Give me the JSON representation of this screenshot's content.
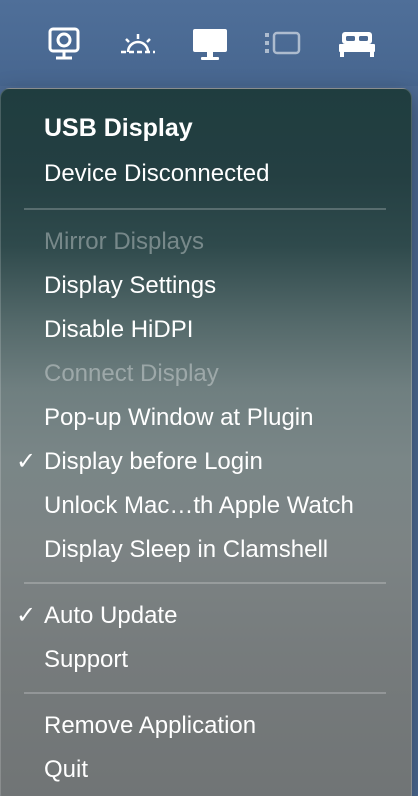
{
  "menubar": {
    "icons": [
      {
        "name": "display-capture-icon"
      },
      {
        "name": "brightness-icon"
      },
      {
        "name": "monitor-icon"
      },
      {
        "name": "sidebar-layout-icon"
      },
      {
        "name": "bed-sleep-icon"
      }
    ]
  },
  "menu": {
    "header_title": "USB Display",
    "header_status": "Device Disconnected",
    "items": {
      "mirror_displays": "Mirror Displays",
      "display_settings": "Display Settings",
      "disable_hidpi": "Disable HiDPI",
      "connect_display": "Connect Display",
      "popup_window": "Pop-up Window at Plugin",
      "display_before_login": "Display before Login",
      "unlock_mac": "Unlock Mac…th Apple Watch",
      "display_sleep_clamshell": "Display Sleep in Clamshell",
      "auto_update": "Auto Update",
      "support": "Support",
      "remove_application": "Remove Application",
      "quit": "Quit"
    },
    "checkmark": "✓"
  }
}
